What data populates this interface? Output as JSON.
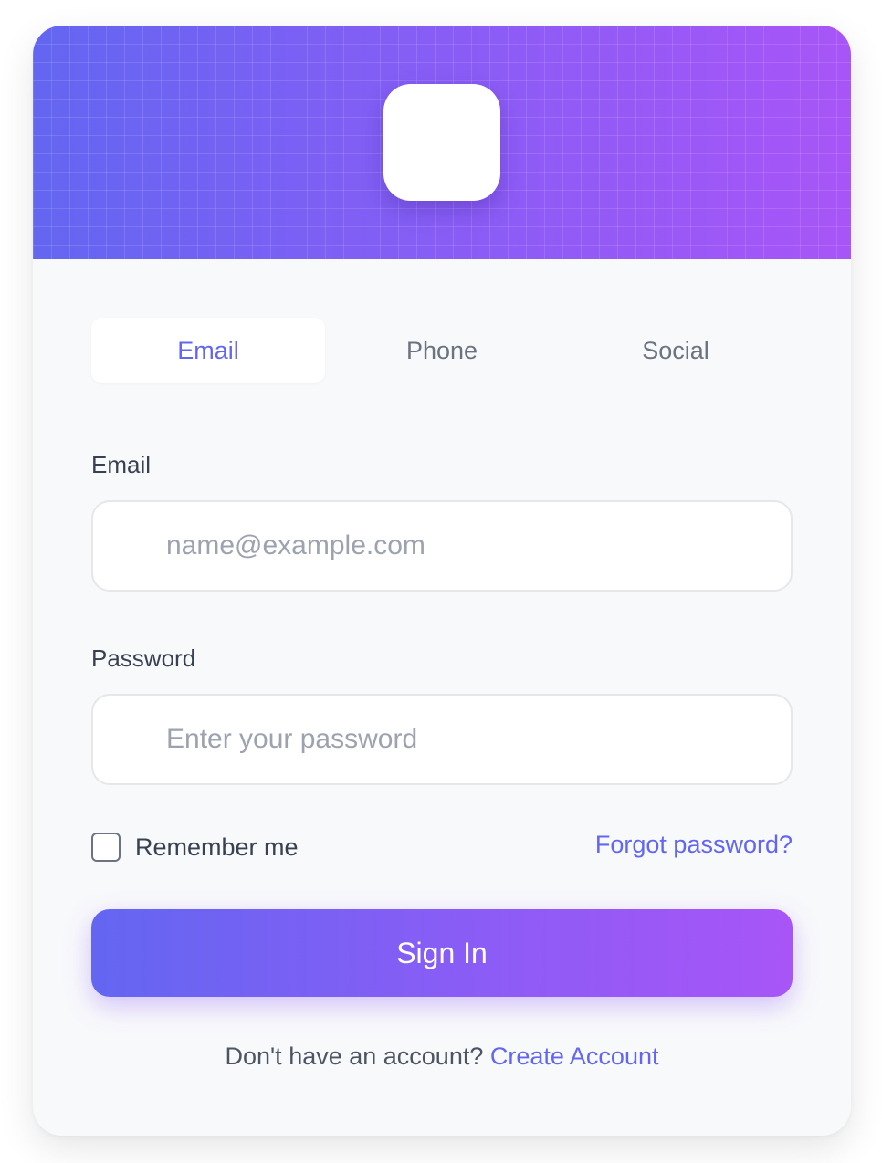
{
  "tabs": [
    {
      "label": "Email",
      "active": true
    },
    {
      "label": "Phone",
      "active": false
    },
    {
      "label": "Social",
      "active": false
    }
  ],
  "email": {
    "label": "Email",
    "placeholder": "name@example.com",
    "value": ""
  },
  "password": {
    "label": "Password",
    "placeholder": "Enter your password",
    "value": ""
  },
  "remember": {
    "label": "Remember me",
    "checked": false
  },
  "forgot": {
    "label": "Forgot password?"
  },
  "signin": {
    "label": "Sign In"
  },
  "footer": {
    "prompt": "Don't have an account?",
    "link": "Create Account"
  },
  "colors": {
    "accent": "#6366f1",
    "gradient_start": "#6366f1",
    "gradient_end": "#a855f7",
    "card_background": "#f8f9fb"
  }
}
